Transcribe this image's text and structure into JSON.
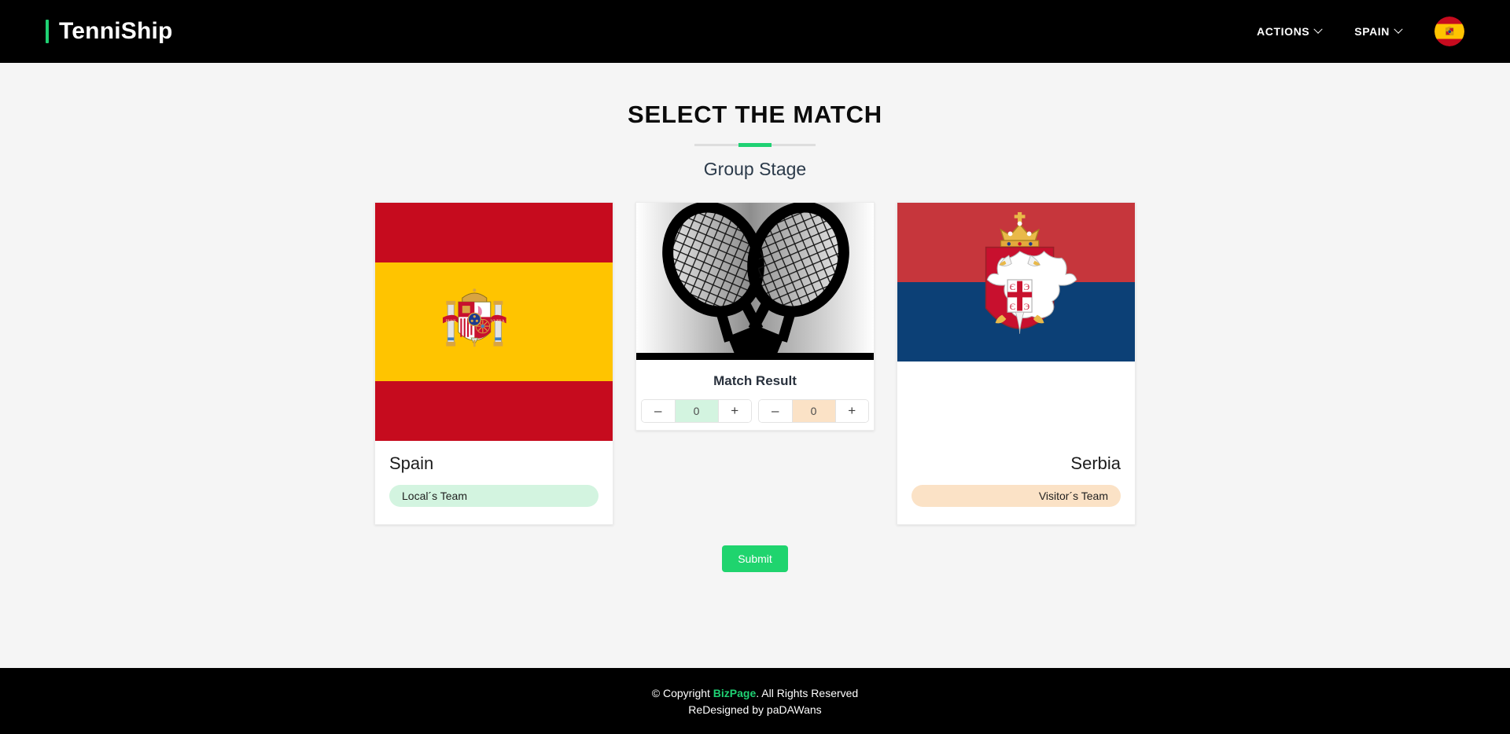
{
  "header": {
    "brand": "TenniShip",
    "nav_items": [
      {
        "label": "ACTIONS",
        "icon": "chevron-down-icon"
      },
      {
        "label": "SPAIN",
        "icon": "chevron-down-icon"
      }
    ],
    "avatar_icon": "spain-flag-avatar"
  },
  "main": {
    "title": "SELECT THE MATCH",
    "subtitle": "Group Stage",
    "submit_label": "Submit"
  },
  "local": {
    "name": "Spain",
    "badge": "Local´s Team",
    "flag_icon": "spain-flag-icon",
    "accent_color": "#d3f4e0",
    "score": "0",
    "minus_label": "–",
    "plus_label": "+"
  },
  "visitor": {
    "name": "Serbia",
    "badge": "Visitor´s Team",
    "flag_icon": "serbia-flag-icon",
    "accent_color": "#fbe2c6",
    "score": "0",
    "minus_label": "–",
    "plus_label": "+"
  },
  "result": {
    "title": "Match Result",
    "image_icon": "crossed-tennis-rackets-icon"
  },
  "footer": {
    "copyright_prefix": "© Copyright ",
    "copyright_brand": "BizPage",
    "copyright_suffix": ". All Rights Reserved",
    "credit": "ReDesigned by paDAWans"
  },
  "colors": {
    "accent_green": "#1fd173",
    "submit_green": "#1fd46e",
    "local_tint": "#d3f4e0",
    "visitor_tint": "#fbe2c6",
    "header_bg": "#000000",
    "page_bg": "#f5f5f5"
  }
}
